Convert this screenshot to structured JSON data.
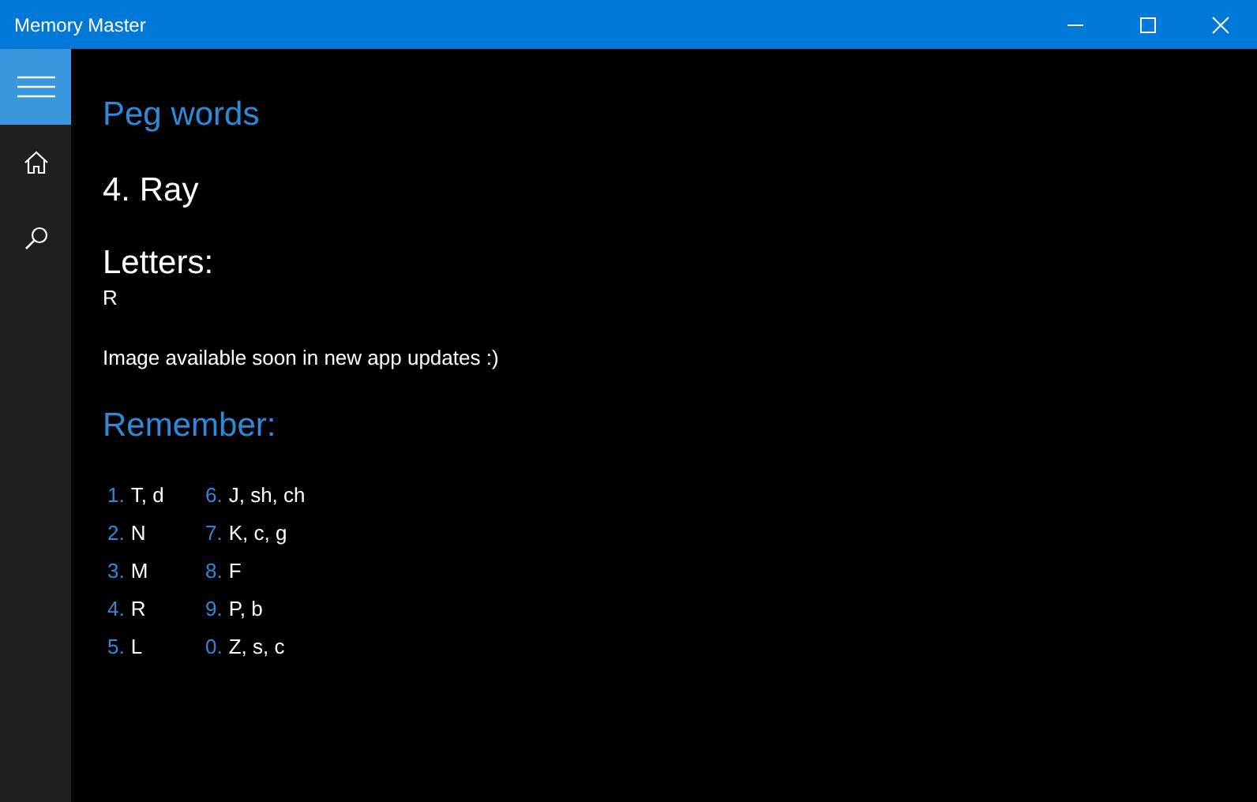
{
  "window": {
    "title": "Memory Master"
  },
  "page": {
    "heading": "Peg words",
    "word": "4. Ray",
    "letters_label": "Letters:",
    "letters": "R",
    "note": "Image available soon in new app updates :)",
    "remember_heading": "Remember:"
  },
  "remember": [
    {
      "number": "1.",
      "letters": "T, d"
    },
    {
      "number": "2.",
      "letters": "N"
    },
    {
      "number": "3.",
      "letters": "M"
    },
    {
      "number": "4.",
      "letters": "R"
    },
    {
      "number": "5.",
      "letters": "L"
    },
    {
      "number": "6.",
      "letters": "J, sh, ch"
    },
    {
      "number": "7.",
      "letters": "K, c, g"
    },
    {
      "number": "8.",
      "letters": "F"
    },
    {
      "number": "9.",
      "letters": "P, b"
    },
    {
      "number": "0.",
      "letters": "Z, s, c"
    }
  ]
}
